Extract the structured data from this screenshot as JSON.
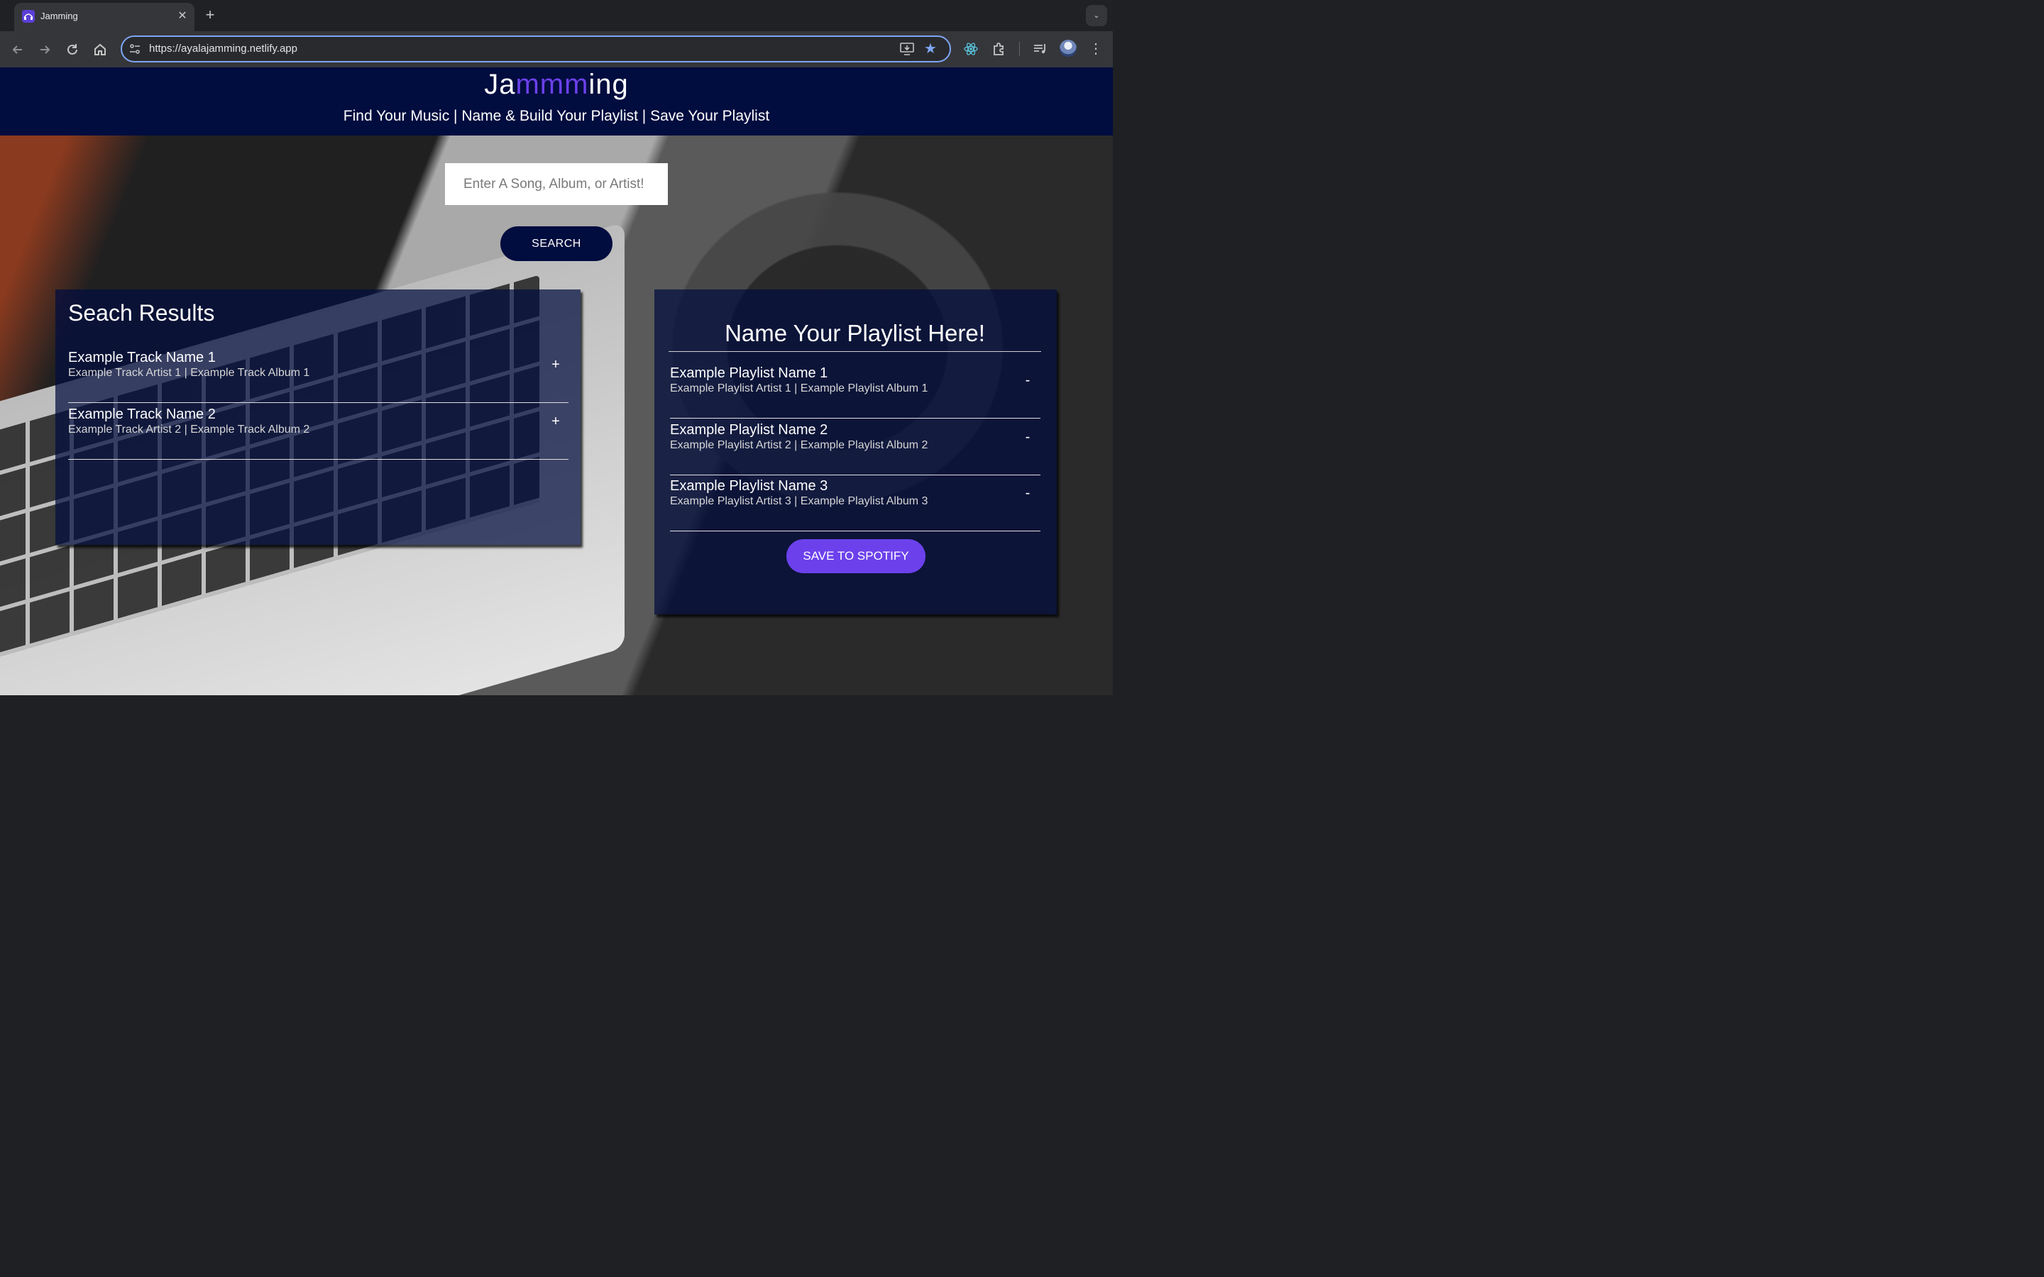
{
  "browser": {
    "tab_title": "Jamming",
    "tab_close": "✕",
    "new_tab": "+",
    "url": "https://ayalajamming.netlify.app",
    "star": "★",
    "menu": "⋮",
    "tab_search": "⌄"
  },
  "header": {
    "logo_start": "Ja",
    "logo_accent": "mmm",
    "logo_end": "ing",
    "tagline": "Find Your Music | Name & Build Your Playlist | Save Your Playlist",
    "accent_color": "#6c41ec",
    "background_color": "#010c3f"
  },
  "search": {
    "placeholder": "Enter A Song, Album, or Artist!",
    "button_label": "SEARCH"
  },
  "results": {
    "title": "Seach Results",
    "tracks": [
      {
        "name": "Example Track Name 1",
        "meta": "Example Track Artist 1 | Example Track Album 1",
        "action": "+"
      },
      {
        "name": "Example Track Name 2",
        "meta": "Example Track Artist 2 | Example Track Album 2",
        "action": "+"
      }
    ]
  },
  "playlist": {
    "name": "Name Your Playlist Here!",
    "tracks": [
      {
        "name": "Example Playlist Name 1",
        "meta": "Example Playlist Artist 1 | Example Playlist Album 1",
        "action": "-"
      },
      {
        "name": "Example Playlist Name 2",
        "meta": "Example Playlist Artist 2 | Example Playlist Album 2",
        "action": "-"
      },
      {
        "name": "Example Playlist Name 3",
        "meta": "Example Playlist Artist 3 | Example Playlist Album 3",
        "action": "-"
      }
    ],
    "save_label": "SAVE TO SPOTIFY"
  }
}
